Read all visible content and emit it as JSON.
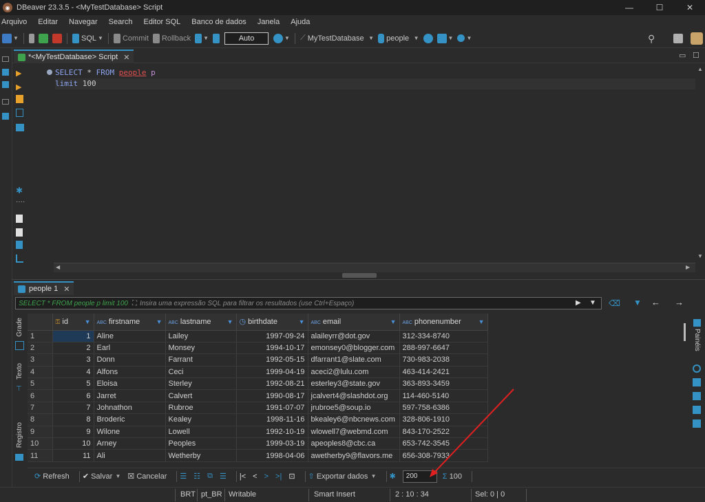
{
  "window": {
    "title": "DBeaver 23.3.5 - <MyTestDatabase> Script",
    "min": "—",
    "max": "☐",
    "close": "✕"
  },
  "menu": [
    "Arquivo",
    "Editar",
    "Navegar",
    "Search",
    "Editor SQL",
    "Banco de dados",
    "Janela",
    "Ajuda"
  ],
  "toolbar": {
    "sql_label": "SQL",
    "commit_label": "Commit",
    "rollback_label": "Rollback",
    "transaction_mode": "Auto",
    "datasource": "MyTestDatabase",
    "schema": "people"
  },
  "editor": {
    "tab_label": "*<MyTestDatabase> Script",
    "line1": {
      "kw1": "SELECT",
      "star": " * ",
      "kw2": "FROM",
      "table": "people",
      "alias": " p"
    },
    "line2": {
      "kw": "limit",
      "value": " 100"
    }
  },
  "results": {
    "tab_label": "people 1",
    "filter_query": "SELECT * FROM people p limit 100",
    "filter_placeholder": "Insira uma expressão SQL para filtrar os resultados (use Ctrl+Espaço)",
    "side_tabs": [
      "Grade",
      "Texto",
      "Registro"
    ],
    "right_panel_label": "Painéis",
    "columns": [
      {
        "name": "id",
        "type": "key"
      },
      {
        "name": "firstname",
        "type": "ABC"
      },
      {
        "name": "lastname",
        "type": "ABC"
      },
      {
        "name": "birthdate",
        "type": "date"
      },
      {
        "name": "email",
        "type": "ABC"
      },
      {
        "name": "phonenumber",
        "type": "ABC"
      }
    ],
    "rows": [
      [
        "1",
        "1",
        "Aline",
        "Lailey",
        "1997-09-24",
        "alaileyrr@dot.gov",
        "312-334-8740"
      ],
      [
        "2",
        "2",
        "Earl",
        "Monsey",
        "1994-10-17",
        "emonsey0@blogger.com",
        "288-997-6647"
      ],
      [
        "3",
        "3",
        "Donn",
        "Farrant",
        "1992-05-15",
        "dfarrant1@slate.com",
        "730-983-2038"
      ],
      [
        "4",
        "4",
        "Alfons",
        "Ceci",
        "1999-04-19",
        "aceci2@lulu.com",
        "463-414-2421"
      ],
      [
        "5",
        "5",
        "Eloisa",
        "Sterley",
        "1992-08-21",
        "esterley3@state.gov",
        "363-893-3459"
      ],
      [
        "6",
        "6",
        "Jarret",
        "Calvert",
        "1990-08-17",
        "jcalvert4@slashdot.org",
        "114-460-5140"
      ],
      [
        "7",
        "7",
        "Johnathon",
        "Rubroe",
        "1991-07-07",
        "jrubroe5@soup.io",
        "597-758-6386"
      ],
      [
        "8",
        "8",
        "Broderic",
        "Kealey",
        "1998-11-16",
        "bkealey6@nbcnews.com",
        "328-806-1910"
      ],
      [
        "9",
        "9",
        "Wilone",
        "Lowell",
        "1992-10-19",
        "wlowell7@webmd.com",
        "843-170-2522"
      ],
      [
        "10",
        "10",
        "Arney",
        "Peoples",
        "1999-03-19",
        "apeoples8@cbc.ca",
        "653-742-3545"
      ],
      [
        "11",
        "11",
        "Ali",
        "Wetherby",
        "1998-04-06",
        "awetherby9@flavors.me",
        "656-308-7933"
      ]
    ],
    "bottom": {
      "refresh": "Refresh",
      "save": "Salvar",
      "cancel": "Cancelar",
      "export": "Exportar dados",
      "fetch_size": "200",
      "row_count": "100"
    }
  },
  "status": {
    "timezone": "BRT",
    "locale": "pt_BR",
    "mode": "Writable",
    "insert": "Smart Insert",
    "position": "2 : 10 : 34",
    "selection": "Sel: 0 | 0"
  }
}
